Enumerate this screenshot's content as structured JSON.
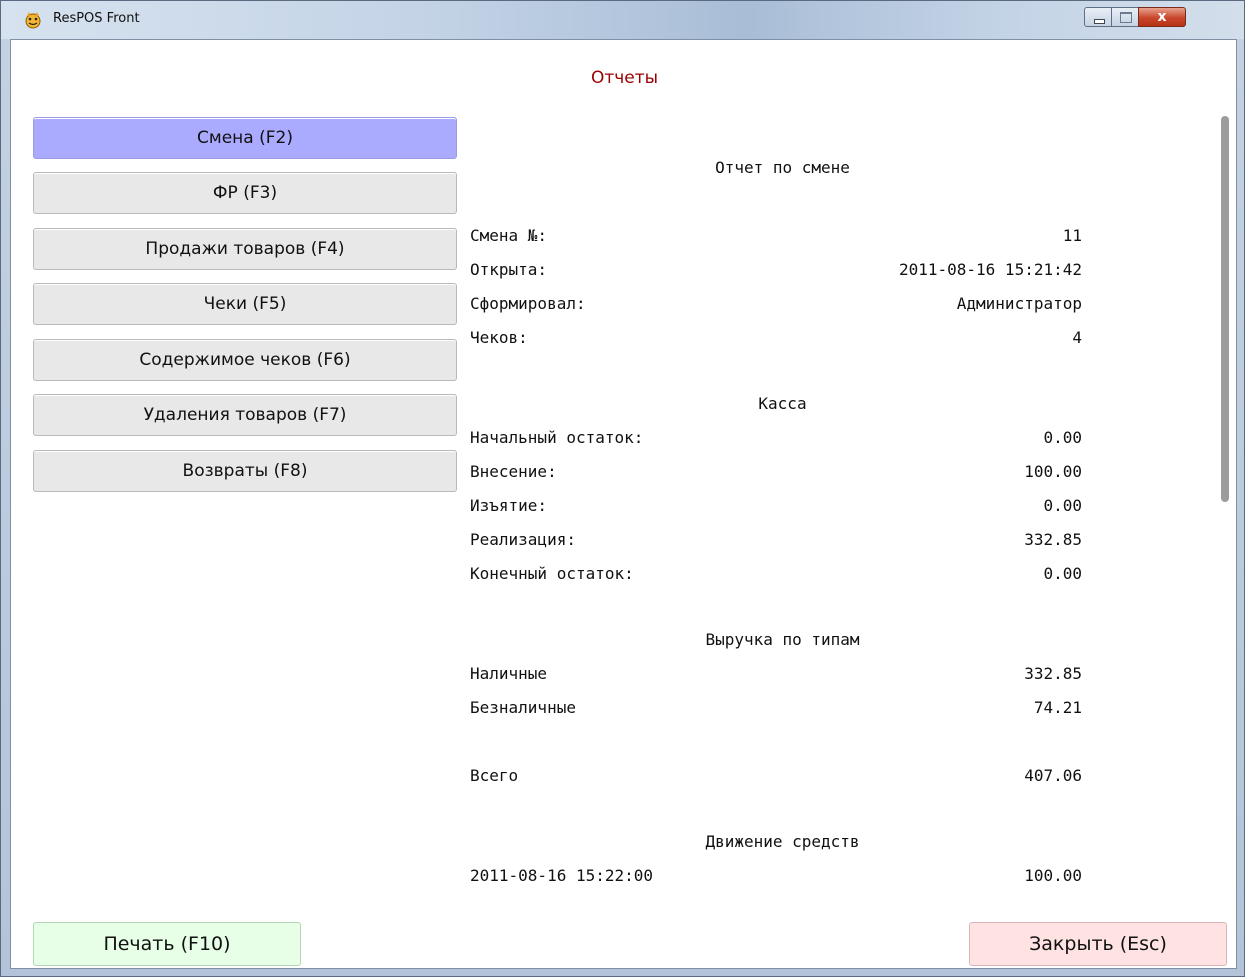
{
  "window": {
    "title": "ResPOS Front",
    "close_glyph": "x"
  },
  "header": {
    "title": "Отчеты"
  },
  "nav": [
    {
      "label": "Смена (F2)",
      "active": true
    },
    {
      "label": "ФР (F3)"
    },
    {
      "label": "Продажи товаров (F4)"
    },
    {
      "label": "Чеки (F5)"
    },
    {
      "label": "Содержимое чеков (F6)"
    },
    {
      "label": "Удаления товаров (F7)"
    },
    {
      "label": "Возвраты (F8)"
    }
  ],
  "report": {
    "title": "Отчет по смене",
    "shift_info": [
      {
        "label": "Смена №:",
        "value": "11"
      },
      {
        "label": "Открыта:",
        "value": "2011-08-16 15:21:42"
      },
      {
        "label": "Сформировал:",
        "value": "Администратор"
      },
      {
        "label": "Чеков:",
        "value": "4"
      }
    ],
    "cash_title": "Касса",
    "cash": [
      {
        "label": "Начальный остаток:",
        "value": "0.00"
      },
      {
        "label": "Внесение:",
        "value": "100.00"
      },
      {
        "label": "Изъятие:",
        "value": "0.00"
      },
      {
        "label": "Реализация:",
        "value": "332.85"
      },
      {
        "label": "Конечный остаток:",
        "value": "0.00"
      }
    ],
    "revenue_title": "Выручка по типам",
    "revenue": [
      {
        "label": "Наличные",
        "value": "332.85"
      },
      {
        "label": "Безналичные",
        "value": "74.21"
      }
    ],
    "total": {
      "label": "Всего",
      "value": "407.06"
    },
    "movement_title": "Движение средств",
    "movement": [
      {
        "label": "2011-08-16 15:22:00",
        "value": "100.00"
      }
    ]
  },
  "footer": {
    "print_label": "Печать (F10)",
    "close_label": "Закрыть (Esc)"
  },
  "colors": {
    "active_nav": "#aaaaff",
    "header_title": "#9b0000",
    "print_bg": "#e6ffe6",
    "close_bg": "#ffe3e3"
  }
}
